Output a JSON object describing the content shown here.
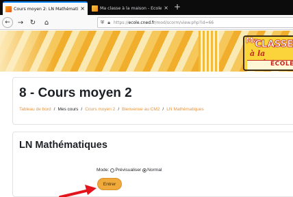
{
  "browser": {
    "tabs": [
      {
        "title": "Cours moyen 2: LN Mathémati",
        "active": true
      },
      {
        "title": "Ma classe à la maison - École",
        "active": false
      }
    ],
    "close_glyph": "×",
    "new_tab_glyph": "+",
    "url": {
      "prefix": "https://",
      "host": "ecole.cned.fr",
      "path": "/mod/scorm/view.php?id=66"
    },
    "icons": [
      "back-icon",
      "forward-icon",
      "reload-icon",
      "home-icon",
      "shield-icon",
      "lock-icon"
    ]
  },
  "banner": {
    "logo": {
      "ma": "Ma",
      "classe": "CLASSE",
      "maison": "à la maison",
      "ecole": "ÉCOLE"
    },
    "colors": {
      "primary": "#f1ae2c",
      "light": "#fbe9b4",
      "brand_red": "#c1261f"
    }
  },
  "header": {
    "page_title": "8 - Cours moyen 2",
    "breadcrumb": [
      {
        "label": "Tableau de bord",
        "link": true
      },
      {
        "label": "Mes cours",
        "link": false
      },
      {
        "label": "Cours moyen 2",
        "link": true
      },
      {
        "label": "Bienvenue au CM2",
        "link": true
      },
      {
        "label": "LN Mathématiques",
        "link": true
      }
    ],
    "separator": "/"
  },
  "main": {
    "section_title": "LN Mathématiques",
    "mode_label": "Mode:",
    "mode_options": [
      {
        "label": "Prévisualiser",
        "checked": false
      },
      {
        "label": "Normal",
        "checked": true
      }
    ],
    "enter_button": "Entrer",
    "accent_color": "#f0a93b"
  }
}
